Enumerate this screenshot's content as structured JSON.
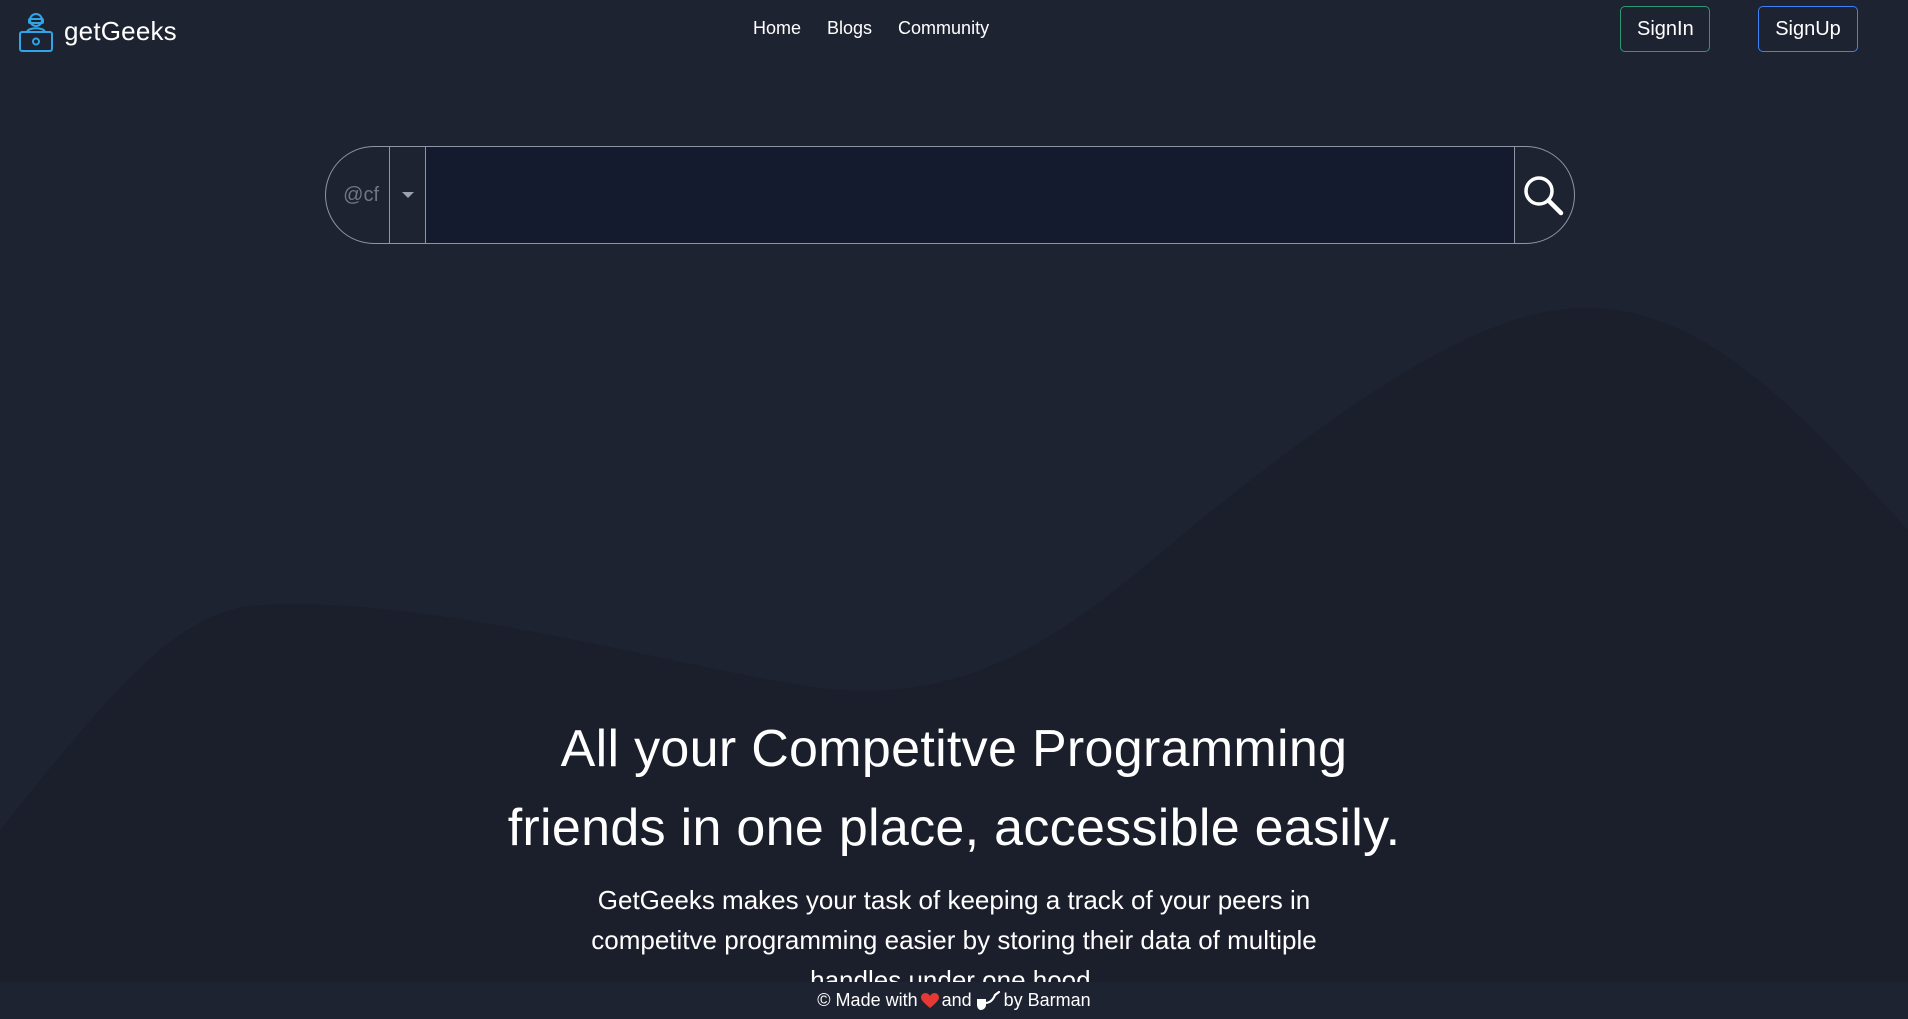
{
  "brand": {
    "name": "getGeeks",
    "icon": "hacker-laptop-icon",
    "accent": "#2fa4e7"
  },
  "nav": {
    "links": [
      "Home",
      "Blogs",
      "Community"
    ]
  },
  "auth": {
    "signin_label": "SignIn",
    "signup_label": "SignUp",
    "signin_border": "#2b9a74",
    "signup_border": "#3b82f6"
  },
  "search": {
    "handle_prefix": "@cf",
    "value": "",
    "dropdown_icon": "caret-down-icon",
    "button_icon": "search-icon"
  },
  "hero": {
    "title_line1": "All your Competitve Programming",
    "title_line2": "friends in one place, accessible easily.",
    "description": "GetGeeks makes your task of keeping a track of your peers in competitve programming easier by storing their data of multiple handles under one hood."
  },
  "footer": {
    "made_with": "© Made with",
    "and": "and",
    "by": "by Barman",
    "icons": [
      "heart-icon",
      "pipe-icon"
    ]
  },
  "colors": {
    "background": "#1e2332",
    "wave": "#1b1f2c",
    "input_bg": "#141b2e"
  }
}
